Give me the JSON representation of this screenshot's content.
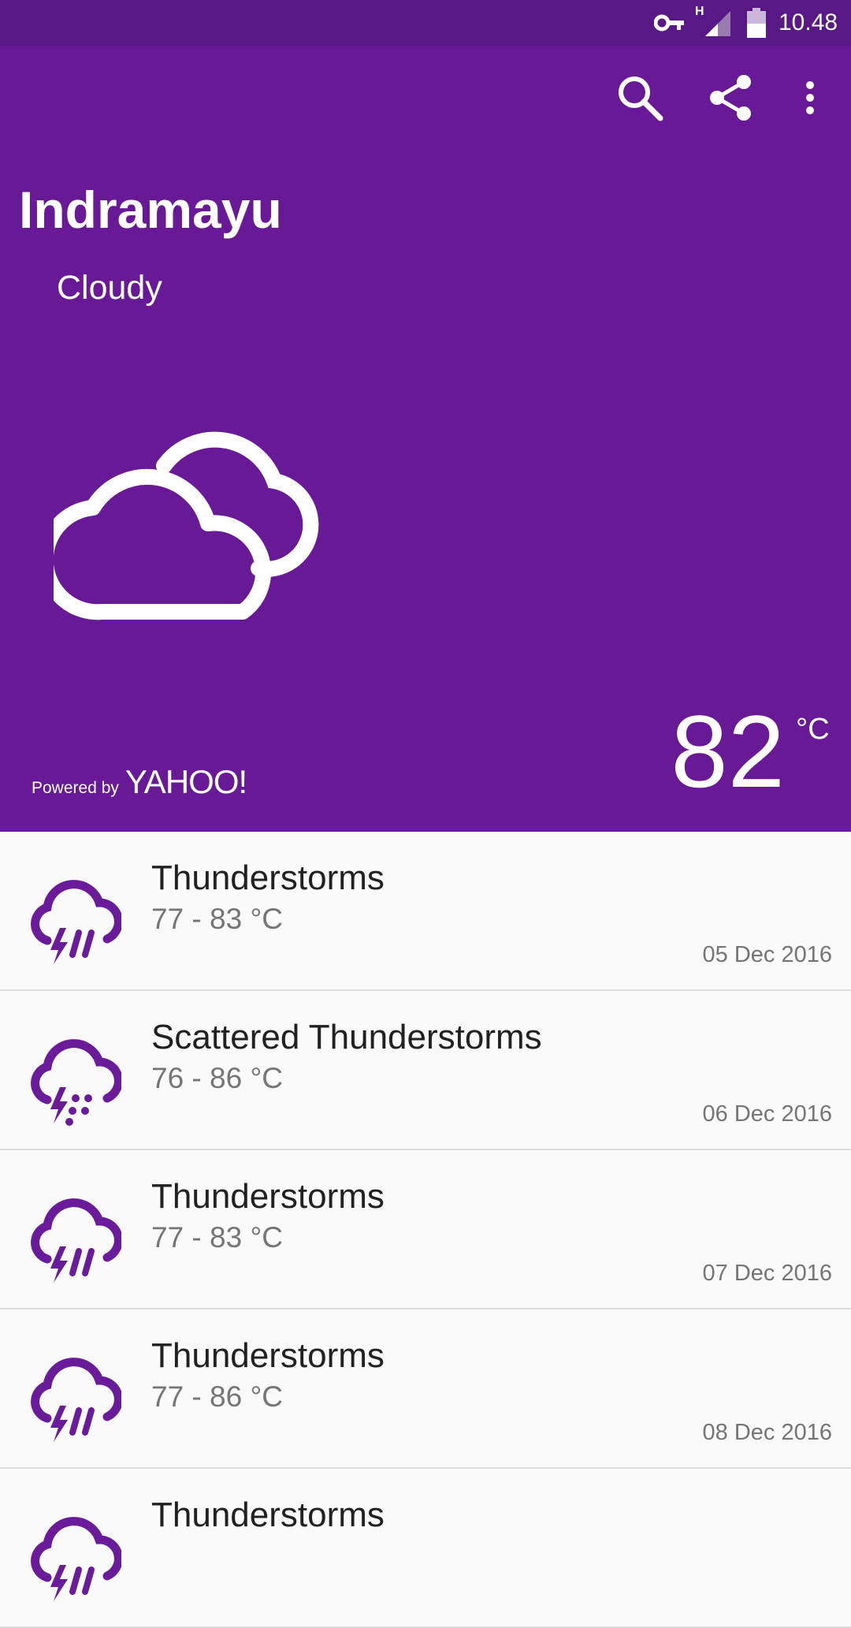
{
  "status_bar": {
    "network": "H",
    "time": "10.48",
    "icons": [
      "vpn-key-icon",
      "signal-icon",
      "battery-icon"
    ]
  },
  "toolbar": {
    "icons": [
      "search-icon",
      "share-icon",
      "more-vert-icon"
    ]
  },
  "current": {
    "city": "Indramayu",
    "condition": "Cloudy",
    "icon": "cloudy-icon",
    "temperature": "82",
    "unit": "°C",
    "powered_prefix": "Powered by",
    "powered_brand": "YAHOO!"
  },
  "forecast": [
    {
      "condition": "Thunderstorms",
      "range": "77 - 83 °C",
      "date": "05 Dec 2016",
      "icon": "thunderstorm-icon"
    },
    {
      "condition": "Scattered Thunderstorms",
      "range": "76 - 86 °C",
      "date": "06 Dec 2016",
      "icon": "scattered-thunderstorm-icon"
    },
    {
      "condition": "Thunderstorms",
      "range": "77 - 83 °C",
      "date": "07 Dec 2016",
      "icon": "thunderstorm-icon"
    },
    {
      "condition": "Thunderstorms",
      "range": "77 - 86 °C",
      "date": "08 Dec 2016",
      "icon": "thunderstorm-icon"
    },
    {
      "condition": "Thunderstorms",
      "range": "",
      "date": "",
      "icon": "thunderstorm-icon"
    }
  ],
  "colors": {
    "primary": "#681a96",
    "status_bar": "#581886",
    "icon_accent": "#6a1b9a"
  }
}
